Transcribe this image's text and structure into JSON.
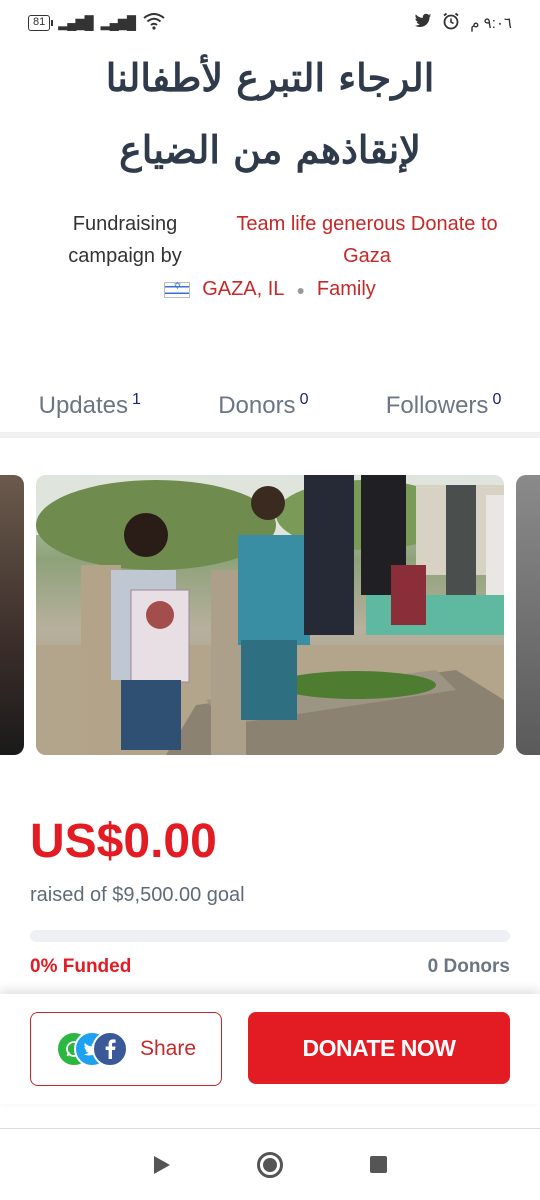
{
  "status_bar": {
    "battery": "81",
    "time": "٩:٠٦ م"
  },
  "campaign": {
    "title_line1": "الرجاء التبرع لأطفالنا",
    "title_line2": "لإنقاذهم من الضياع",
    "organizer_label": "Fundraising campaign by",
    "organizer_name": "Team life generous Donate to Gaza",
    "location": "GAZA, IL",
    "category": "Family"
  },
  "tabs": [
    {
      "label": "Updates",
      "count": "1"
    },
    {
      "label": "Donors",
      "count": "0"
    },
    {
      "label": "Followers",
      "count": "0"
    }
  ],
  "funding": {
    "raised": "US$0.00",
    "goal_text": "raised of $9,500.00 goal",
    "funded_text": "0% Funded",
    "funded_fraction": 0,
    "donors_text": "0 Donors"
  },
  "actions": {
    "share_label": "Share",
    "donate_label": "DONATE NOW"
  },
  "colors": {
    "accent": "#e31b23",
    "link": "#c62828",
    "text": "#2f3b4a"
  }
}
